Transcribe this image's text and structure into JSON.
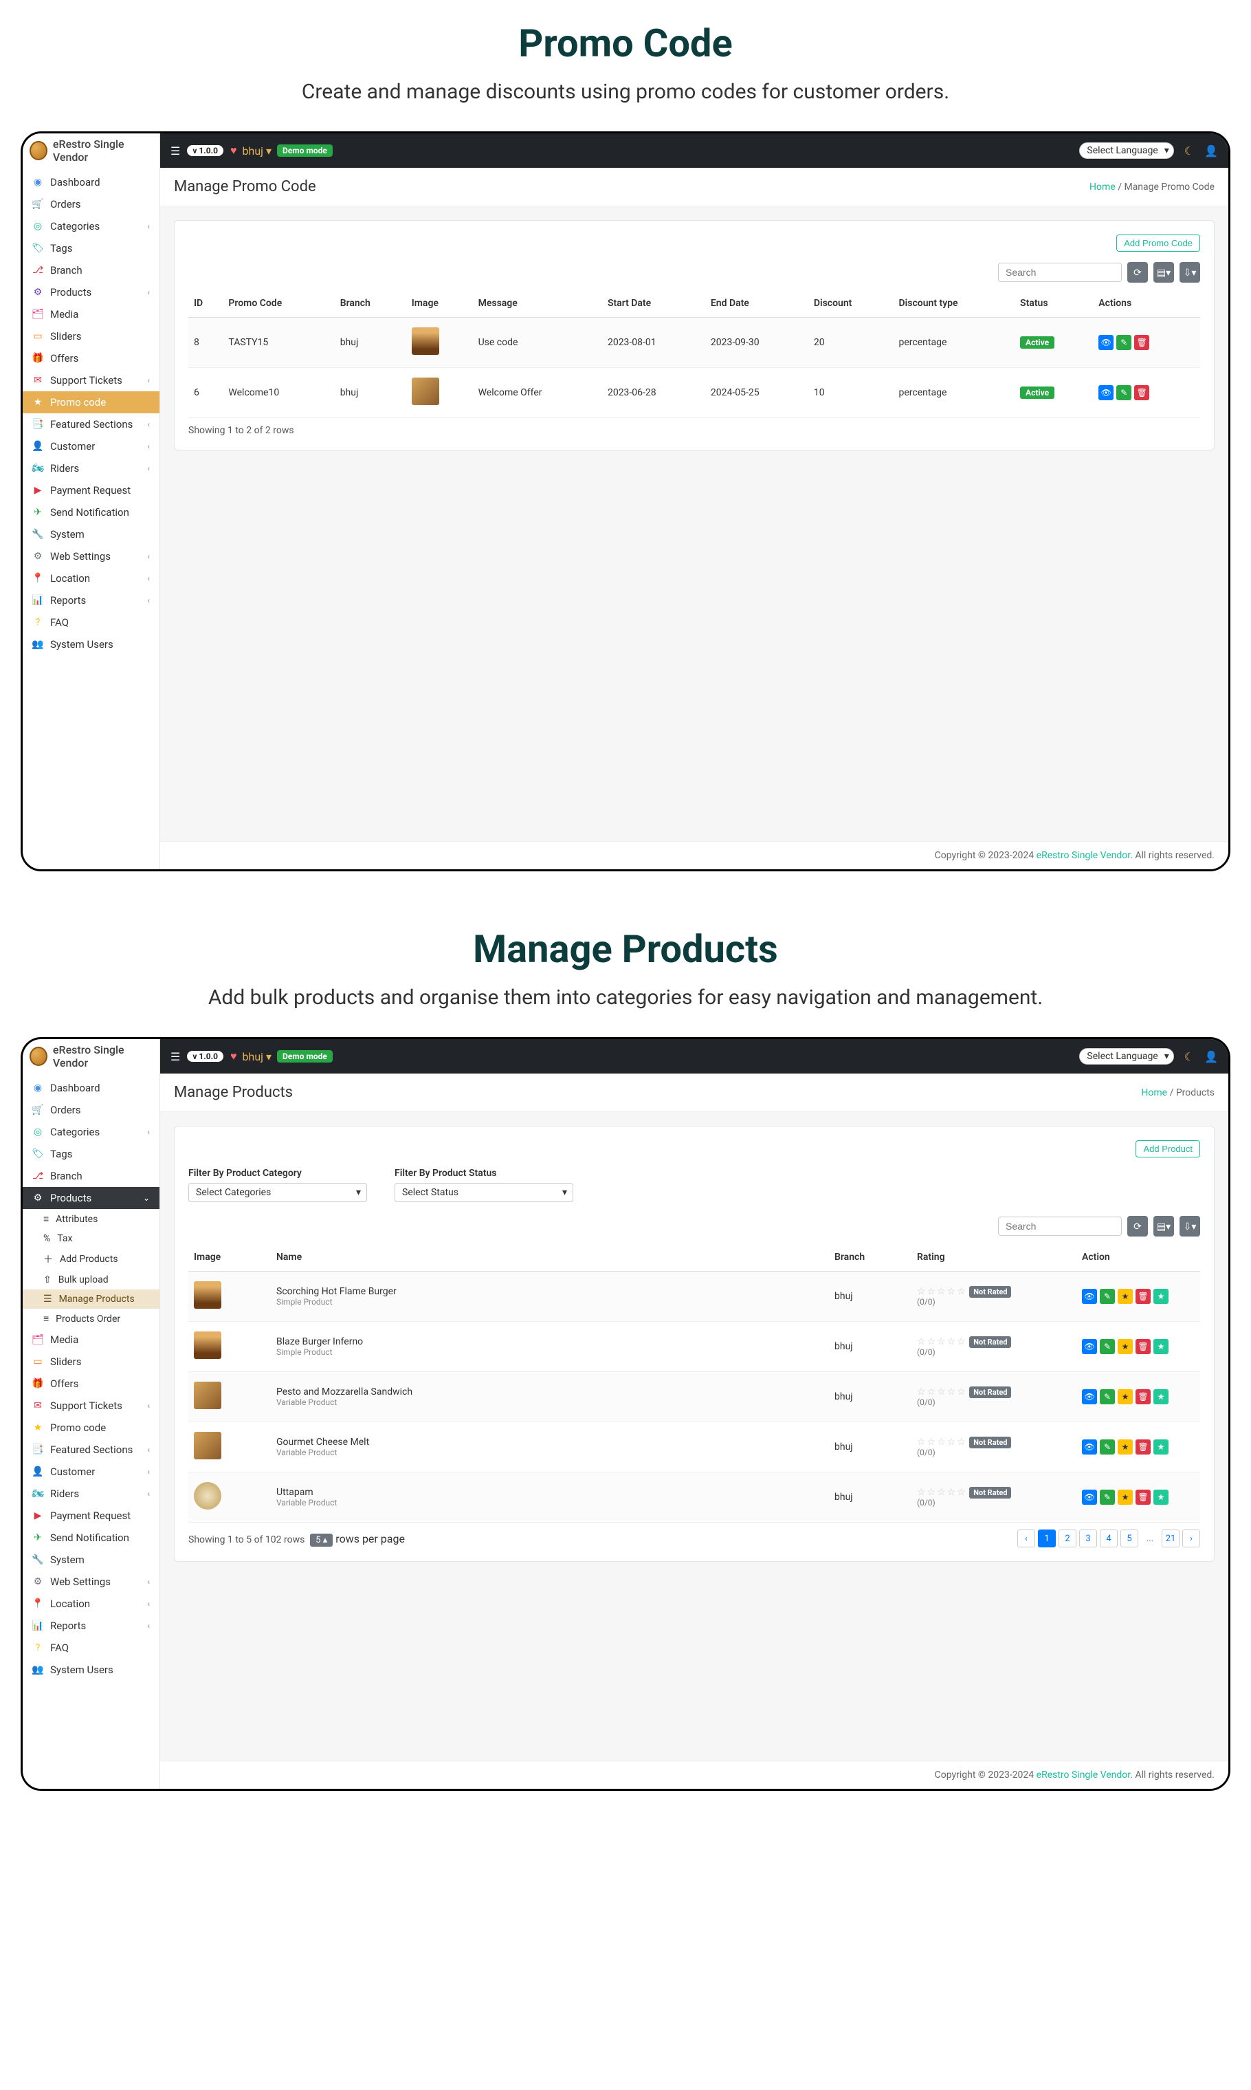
{
  "section1": {
    "title": "Promo Code",
    "desc": "Create and manage discounts using promo codes for customer orders."
  },
  "section2": {
    "title": "Manage Products",
    "desc": "Add bulk products and organise them into categories for easy navigation and management."
  },
  "brand": "eRestro Single Vendor",
  "topbar": {
    "version": "v 1.0.0",
    "branch": "bhuj",
    "demo": "Demo mode",
    "language": "Select Language"
  },
  "sidebar": {
    "items": [
      "Dashboard",
      "Orders",
      "Categories",
      "Tags",
      "Branch",
      "Products",
      "Media",
      "Sliders",
      "Offers",
      "Support Tickets",
      "Promo code",
      "Featured Sections",
      "Customer",
      "Riders",
      "Payment Request",
      "Send Notification",
      "System",
      "Web Settings",
      "Location",
      "Reports",
      "FAQ",
      "System Users"
    ],
    "products_sub": [
      "Attributes",
      "Tax",
      "Add Products",
      "Bulk upload",
      "Manage Products",
      "Products Order"
    ]
  },
  "promo_page": {
    "title": "Manage Promo Code",
    "breadcrumb_home": "Home",
    "breadcrumb_cur": "Manage Promo Code",
    "add_btn": "Add Promo Code",
    "search_placeholder": "Search",
    "columns": [
      "ID",
      "Promo Code",
      "Branch",
      "Image",
      "Message",
      "Start Date",
      "End Date",
      "Discount",
      "Discount type",
      "Status",
      "Actions"
    ],
    "rows": [
      {
        "id": "8",
        "code": "TASTY15",
        "branch": "bhuj",
        "message": "Use code",
        "start": "2023-08-01",
        "end": "2023-09-30",
        "discount": "20",
        "type": "percentage",
        "status": "Active"
      },
      {
        "id": "6",
        "code": "Welcome10",
        "branch": "bhuj",
        "message": "Welcome Offer",
        "start": "2023-06-28",
        "end": "2024-05-25",
        "discount": "10",
        "type": "percentage",
        "status": "Active"
      }
    ],
    "showing": "Showing 1 to 2 of 2 rows"
  },
  "products_page": {
    "title": "Manage Products",
    "breadcrumb_home": "Home",
    "breadcrumb_cur": "Products",
    "add_btn": "Add Product",
    "filter_cat_label": "Filter By Product Category",
    "filter_cat_val": "Select Categories",
    "filter_status_label": "Filter By Product Status",
    "filter_status_val": "Select Status",
    "search_placeholder": "Search",
    "columns": [
      "Image",
      "Name",
      "Branch",
      "Rating",
      "Action"
    ],
    "rows": [
      {
        "name": "Scorching Hot Flame Burger",
        "subtype": "Simple Product",
        "branch": "bhuj",
        "stars": "☆☆☆☆☆",
        "notrated": "Not Rated",
        "rating_sub": "(0/0)"
      },
      {
        "name": "Blaze Burger Inferno",
        "subtype": "Simple Product",
        "branch": "bhuj",
        "stars": "☆☆☆☆☆",
        "notrated": "Not Rated",
        "rating_sub": "(0/0)"
      },
      {
        "name": "Pesto and Mozzarella Sandwich",
        "subtype": "Variable Product",
        "branch": "bhuj",
        "stars": "☆☆☆☆☆",
        "notrated": "Not Rated",
        "rating_sub": "(0/0)"
      },
      {
        "name": "Gourmet Cheese Melt",
        "subtype": "Variable Product",
        "branch": "bhuj",
        "stars": "☆☆☆☆☆",
        "notrated": "Not Rated",
        "rating_sub": "(0/0)"
      },
      {
        "name": "Uttapam",
        "subtype": "Variable Product",
        "branch": "bhuj",
        "stars": "☆☆☆☆☆",
        "notrated": "Not Rated",
        "rating_sub": "(0/0)"
      }
    ],
    "showing": "Showing 1 to 5 of 102 rows",
    "rows_sel": "5",
    "rows_per": "rows per page",
    "pages": [
      "1",
      "2",
      "3",
      "4",
      "5",
      "...",
      "21"
    ]
  },
  "footer": {
    "copyright": "Copyright © 2023-2024 ",
    "brand": "eRestro Single Vendor",
    "rights": ". All rights reserved."
  },
  "icons": {
    "dashboard": "◉",
    "orders": "🛒",
    "categories": "◎",
    "tags": "🏷",
    "branch": "⎇",
    "products": "⚙",
    "media": "🗂",
    "sliders": "▭",
    "offers": "🎁",
    "support": "✉",
    "promo": "★",
    "featured": "📑",
    "customer": "👤",
    "riders": "🏍",
    "payment": "▶",
    "send": "✈",
    "system": "🔧",
    "web": "⚙",
    "location": "📍",
    "reports": "📊",
    "faq": "?",
    "users": "👥",
    "attributes": "≡",
    "tax": "%",
    "add": "＋",
    "bulk": "⇧",
    "manage": "☰",
    "order": "≡"
  }
}
